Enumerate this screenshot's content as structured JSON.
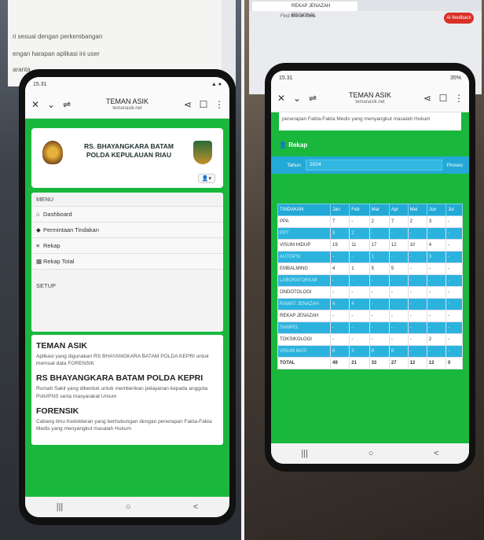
{
  "left_phone": {
    "status": {
      "time": "15.31",
      "battery": ""
    },
    "appbar": {
      "title": "TEMAN ASIK",
      "url": "temanasik.net"
    },
    "hospital_name_line1": "RS. BHAYANGKARA BATAM",
    "hospital_name_line2": "POLDA KEPULAUAN RIAU",
    "menu": {
      "heading": "MENU",
      "items": [
        {
          "icon": "home-icon",
          "glyph": "⌂",
          "label": "Dashboard"
        },
        {
          "icon": "tag-icon",
          "glyph": "◆",
          "label": "Permintaan Tindakan"
        },
        {
          "icon": "list-icon",
          "glyph": "≡",
          "label": "Rekap"
        },
        {
          "icon": "table-icon",
          "glyph": "▦",
          "label": "Rekap Total"
        }
      ],
      "setup": "SETUP"
    },
    "info": [
      {
        "title": "TEMAN ASIK",
        "text": "Aplikasi yang digunakan RS BHAYANGKARA BATAM POLDA KEPRI untuk memuat data FORENSIK"
      },
      {
        "title": "RS BHAYANGKARA BATAM POLDA KEPRI",
        "text": "Rumah Sakit yang dibentuk untuk memberikan pelayanan kepada anggota Polri/PNS serta masyarakat Umum"
      },
      {
        "title": "FORENSIK",
        "text": "Cabang ilmu Kedokteran yang berhubungan dengan penerapan Fakta-Fakta Medis yang menyangkut masalah Hukum"
      }
    ],
    "nav": {
      "recent": "|||",
      "home": "○",
      "back": "<"
    }
  },
  "right_phone": {
    "status": {
      "time": "15.31",
      "battery": "35%"
    },
    "appbar": {
      "title": "TEMAN ASIK",
      "url": "temanasik.net"
    },
    "top_text": "penerapan Fakta-Fakta Medis yang menyangkut masalah Hukum",
    "rekap_title": "Rekap",
    "filter": {
      "label": "Tahun",
      "value": "2024",
      "button": "Proses"
    },
    "table": {
      "headers": [
        "TINDAKAN",
        "Jan",
        "Feb",
        "Mar",
        "Apr",
        "Mei",
        "Jun",
        "Jul"
      ],
      "rows": [
        [
          "PPA",
          "7",
          "-",
          "2",
          "7",
          "2",
          "3",
          "-"
        ],
        [
          "PPT",
          "9",
          "2",
          "-",
          "-",
          "-",
          "-",
          "-"
        ],
        [
          "VISUM HIDUP",
          "19",
          "11",
          "17",
          "12",
          "10",
          "4",
          "-"
        ],
        [
          "AUTOPSI",
          "-",
          "-",
          "1",
          "-",
          "-",
          "3",
          "-"
        ],
        [
          "EMBALMING",
          "4",
          "1",
          "5",
          "5",
          "-",
          "-",
          "-"
        ],
        [
          "LABORATORIUM",
          "-",
          "-",
          "-",
          "-",
          "-",
          "-",
          "-"
        ],
        [
          "ONDOTOLOGI",
          "-",
          "-",
          "-",
          "-",
          "-",
          "-",
          "-"
        ],
        [
          "RAWAT JENAZAH",
          "4",
          "4",
          "-",
          "-",
          "-",
          "-",
          "-"
        ],
        [
          "REKAP JENAZAH",
          "-",
          "-",
          "-",
          "-",
          "-",
          "-",
          "-"
        ],
        [
          "SAMPEL",
          "-",
          "-",
          "-",
          "-",
          "-",
          "-",
          "-"
        ],
        [
          "TOKSIKOLOGI",
          "-",
          "-",
          "-",
          "-",
          "-",
          "2",
          "-"
        ],
        [
          "VISUM MATI",
          "6",
          "3",
          "8",
          "8",
          "-",
          "-",
          "-"
        ]
      ],
      "total": [
        "TOTAL",
        "49",
        "21",
        "33",
        "27",
        "12",
        "12",
        "0"
      ]
    },
    "nav": {
      "recent": "|||",
      "home": "○",
      "back": "<"
    }
  },
  "background": {
    "monitor_left_lines": [
      "ri sesuai dengan perkembangan",
      "engan harapan aplikasi ini user",
      "aranta"
    ],
    "monitor_right_tab1": "",
    "monitor_right_tab2": "REKAP JENAZAH REGIONAL",
    "monitor_right_addr": "Find text or tools",
    "monitor_right_profile": "Ai feedback"
  },
  "colors": {
    "accent_green": "#19b83d",
    "table_blue": "#22a9d6"
  }
}
